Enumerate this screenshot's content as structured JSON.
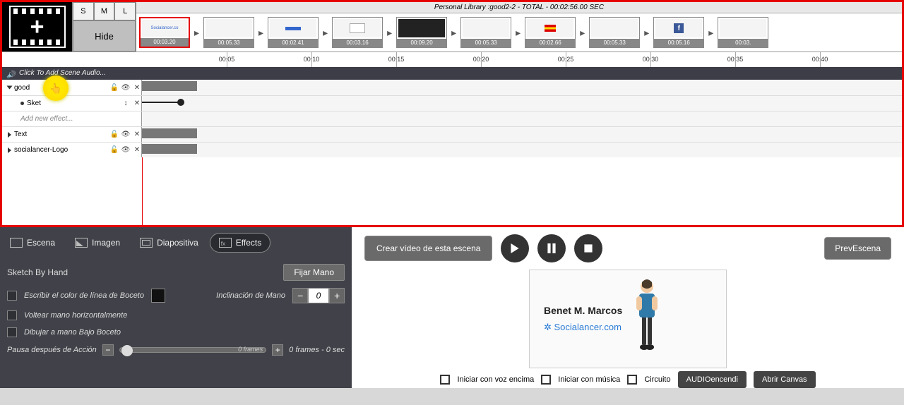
{
  "library_header": "Personal Library :good2-2 - TOTAL - 00:02:56.00 SEC",
  "size_buttons": {
    "s": "S",
    "m": "M",
    "l": "L"
  },
  "hide_label": "Hide",
  "audio_hint": "Click To Add Scene Audio...",
  "ruler_ticks": [
    "00:05",
    "00:10",
    "00:15",
    "00:20",
    "00:25",
    "00:30",
    "00:35",
    "00:40"
  ],
  "thumbs": [
    {
      "dur": "00:03.20",
      "selected": true,
      "label": "Socialancer.co",
      "variant": "text"
    },
    {
      "dur": "00:05.33",
      "selected": false,
      "variant": "blank"
    },
    {
      "dur": "00:02.41",
      "selected": false,
      "variant": "bluebar"
    },
    {
      "dur": "00:03.16",
      "selected": false,
      "variant": "card"
    },
    {
      "dur": "00:09.20",
      "selected": false,
      "variant": "dark"
    },
    {
      "dur": "00:05.33",
      "selected": false,
      "variant": "blank"
    },
    {
      "dur": "00:02.66",
      "selected": false,
      "variant": "flag"
    },
    {
      "dur": "00:05.33",
      "selected": false,
      "variant": "blank"
    },
    {
      "dur": "00:05.16",
      "selected": false,
      "variant": "social"
    },
    {
      "dur": "00:03.",
      "selected": false,
      "variant": "blank"
    }
  ],
  "tracks": {
    "goodz": {
      "label": "good",
      "expanded": true
    },
    "sketch": {
      "label": "Sket"
    },
    "addfx": {
      "label": "Add new effect..."
    },
    "text": {
      "label": "Text"
    },
    "logo": {
      "label": "socialancer-Logo"
    }
  },
  "tabs": {
    "escena": "Escena",
    "imagen": "Imagen",
    "diapositiva": "Diapositiva",
    "effects": "Effects"
  },
  "effects_panel": {
    "title": "Sketch By Hand",
    "fix_hand": "Fijar Mano",
    "write_color": "Escribir el color de línea de Boceto",
    "incline": "Inclinación de Mano",
    "incline_value": "0",
    "flip": "Voltear mano horizontalmente",
    "draw_low": "Dibujar a mano Bajo Boceto",
    "pause_label": "Pausa después de Acción",
    "pause_frames": "0 frames",
    "pause_summary": "0 frames - 0 sec"
  },
  "right_panel": {
    "create_video": "Crear vídeo de esta escena",
    "prev_scene": "PrevEscena",
    "preview_name": "Benet M. Marcos",
    "preview_site": "Socialancer.com",
    "voice_over": "Iniciar con voz encima",
    "with_music": "Iniciar con música",
    "circuit": "Circuito",
    "audio_on": "AUDIOencendi",
    "open_canvas": "Abrir Canvas"
  }
}
